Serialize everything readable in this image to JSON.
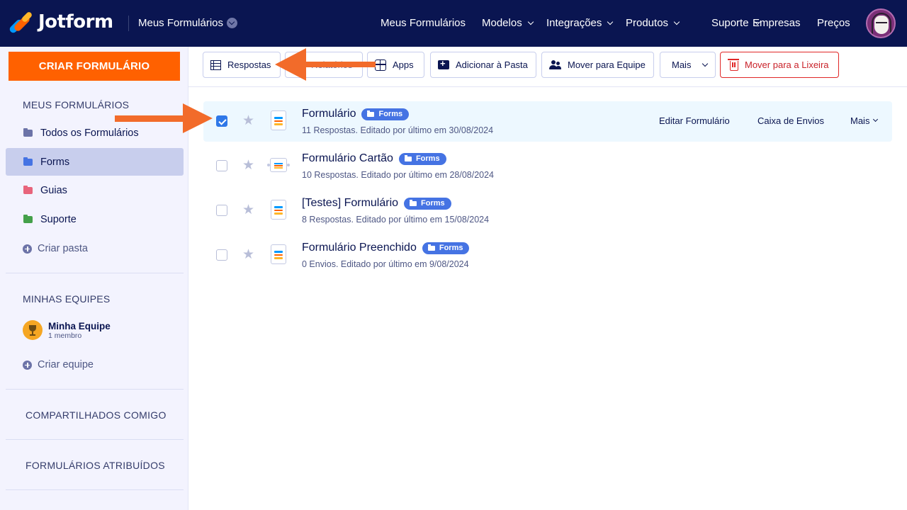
{
  "header": {
    "logo_text": "Jotform",
    "my_forms_label": "Meus Formulários",
    "nav": [
      {
        "label": "Meus Formulários",
        "has_dropdown": false
      },
      {
        "label": "Modelos",
        "has_dropdown": true
      },
      {
        "label": "Integrações",
        "has_dropdown": true
      },
      {
        "label": "Produtos",
        "has_dropdown": true
      },
      {
        "label": "Suporte",
        "has_dropdown": true
      },
      {
        "label": "Empresas",
        "has_dropdown": false
      },
      {
        "label": "Preços",
        "has_dropdown": false
      }
    ]
  },
  "sidebar": {
    "create_button": "CRIAR FORMULÁRIO",
    "my_forms_heading": "MEUS FORMULÁRIOS",
    "folders": [
      {
        "label": "Todos os Formulários",
        "color": "#6c73a8",
        "active": false
      },
      {
        "label": "Forms",
        "color": "#4573e3",
        "active": true
      },
      {
        "label": "Guias",
        "color": "#e8647c",
        "active": false
      },
      {
        "label": "Suporte",
        "color": "#44a04a",
        "active": false
      }
    ],
    "create_folder": "Criar pasta",
    "teams_heading": "MINHAS EQUIPES",
    "team": {
      "name": "Minha Equipe",
      "members": "1 membro"
    },
    "create_team": "Criar equipe",
    "shared_with_me": "COMPARTILHADOS COMIGO",
    "assigned_forms": "FORMULÁRIOS ATRIBUÍDOS"
  },
  "toolbar": {
    "responses": "Respostas",
    "reports": "Relatórios",
    "apps": "Apps",
    "add_to_folder": "Adicionar à Pasta",
    "move_to_team": "Mover para Equipe",
    "more": "Mais",
    "move_to_trash": "Mover para a Lixeira"
  },
  "forms": [
    {
      "title": "Formulário",
      "tag": "Forms",
      "meta": "11 Respostas. Editado por último em 30/08/2024",
      "selected": true,
      "icon": "form"
    },
    {
      "title": "Formulário Cartão",
      "tag": "Forms",
      "meta": "10 Respostas. Editado por último em 28/08/2024",
      "selected": false,
      "icon": "card"
    },
    {
      "title": "[Testes] Formulário",
      "tag": "Forms",
      "meta": "8 Respostas. Editado por último em 15/08/2024",
      "selected": false,
      "icon": "form"
    },
    {
      "title": "Formulário Preenchido",
      "tag": "Forms",
      "meta": "0 Envios. Editado por último em 9/08/2024",
      "selected": false,
      "icon": "form"
    }
  ],
  "row_actions": {
    "edit": "Editar Formulário",
    "inbox": "Caixa de Envios",
    "more": "Mais"
  },
  "colors": {
    "nav_bg": "#0a1551",
    "accent_orange": "#ff6100",
    "selected_row": "#edf8ff",
    "tag_blue": "#4573e3",
    "danger": "#e02727"
  }
}
